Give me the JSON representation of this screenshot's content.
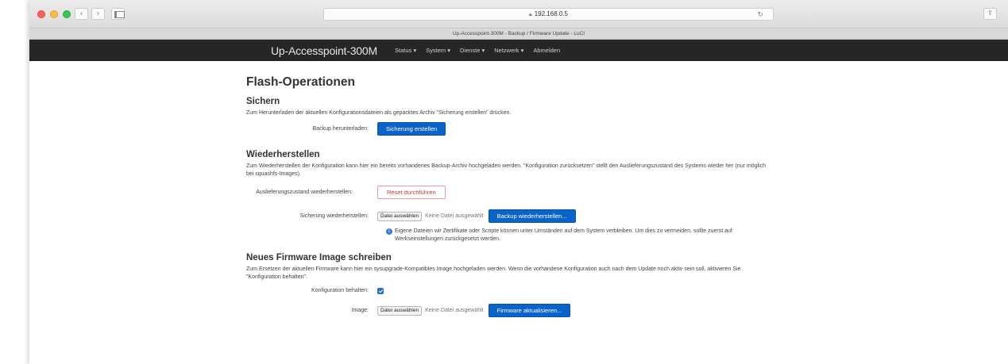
{
  "browser": {
    "address": "192.168.0.5",
    "tab_title": "Up-Accesspoint-300M - Backup / Firmware Update - LuCI"
  },
  "nav": {
    "brand": "Up-Accesspoint-300M",
    "items": [
      "Status ▾",
      "System ▾",
      "Dienste ▾",
      "Netzwerk ▾",
      "Abmelden"
    ]
  },
  "page": {
    "title": "Flash-Operationen",
    "backup": {
      "heading": "Sichern",
      "description": "Zum Herunterladen der aktuellen Konfigurationsdateien als gepacktes Archiv \"Sicherung erstellen\" drücken.",
      "label": "Backup herunterladen:",
      "button": "Sicherung erstellen"
    },
    "restore": {
      "heading": "Wiederherstellen",
      "description": "Zum Wiederherstellen der Konfiguration kann hier ein bereits vorhandenes Backup-Archiv hochgeladen werden. \"Konfiguration zurücksetzen\" stellt den Auslieferungszustand des Systems wieder her (nur möglich bei squashfs-Images).",
      "reset_label": "Auslieferungszustand wiederherstellen:",
      "reset_button": "Reset durchführen",
      "restore_label": "Sicherung wiederherstellen:",
      "file_button": "Datei auswählen",
      "no_file": "Keine Datei ausgewählt",
      "restore_button": "Backup wiederherstellen...",
      "hint": "Eigene Dateien wir Zertifikate oder Scripte können unter Umständen auf dem System verbleiben. Um dies zu vermeiden, sollte zuerst auf Werkseinstellungen zurückgesetzt werden."
    },
    "firmware": {
      "heading": "Neues Firmware Image schreiben",
      "description": "Zum Ersetzen der aktuellen Firmware kann hier ein sysupgrade-Kompatibles Image hochgeladen werden. Wenn die vorhandene Konfiguration auch nach dem Update noch aktiv sein soll, aktivieren Sie \"Konfiguration behalten\".",
      "keep_label": "Konfiguration behalten:",
      "keep_checked": true,
      "image_label": "Image:",
      "file_button": "Datei auswählen",
      "no_file": "Keine Datei ausgewählt",
      "flash_button": "Firmware aktualisieren..."
    }
  }
}
